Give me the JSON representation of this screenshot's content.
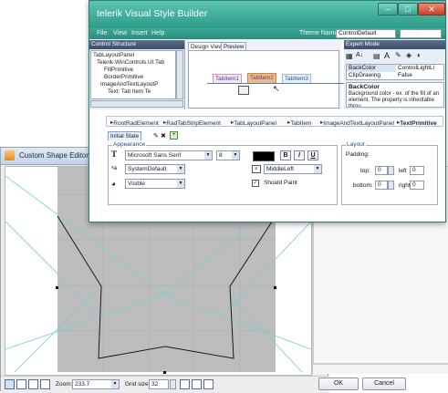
{
  "shape_editor": {
    "title": "Custom Shape Editor",
    "zoom_label": "Zoom:",
    "zoom_value": "233.7",
    "grid_label": "Grid size:",
    "grid_value": "32",
    "ok_label": "OK",
    "cancel_label": "Cancel"
  },
  "builder": {
    "title": "telerik Visual Style Builder",
    "menu": [
      "File",
      "View",
      "Insert",
      "Help"
    ],
    "theme_label": "Theme Name",
    "theme_value": "ControlDefault",
    "zoom_value": "100%",
    "control_structure": {
      "header": "Control Structure",
      "items": [
        "TabLayoutPanel",
        "Telerik.WinControls.UI.Tab",
        "FillPrimitive",
        "BorderPrimitive",
        "ImageAndTextLayoutP",
        "Text: Tab Item Te"
      ]
    },
    "design_tabs": [
      "Design View",
      "Preview"
    ],
    "preview_items": [
      "TabItem1",
      "TabItem2",
      "TabItem3"
    ],
    "expert_mode": {
      "header": "Expert Mode",
      "rows": [
        {
          "name": "BackColor",
          "value": "ControlLightLi"
        },
        {
          "name": "ClipDrawing",
          "value": "False"
        }
      ],
      "desc_title": "BackColor",
      "desc_text": "Background color - ex. of the fill of an element. The property is inheritable throu..."
    },
    "breadcrumb": [
      "RootRadElement",
      "RadTabStripElement",
      "TabLayoutPanel",
      "TabItem",
      "ImageAndTextLayoutPanel",
      "TextPrimitive"
    ],
    "state_tab": "Initial State",
    "appearance": {
      "label": "Appearance",
      "font_name": "Microsoft Sans Serif",
      "font_size": "8",
      "bold": "B",
      "italic": "I",
      "underline": "U",
      "rendering": "SystemDefault",
      "alignment": "MiddleLeft",
      "visibility": "Visible",
      "should_paint_label": "Should Paint",
      "should_paint_checked": true
    },
    "layout": {
      "label": "Layout",
      "padding_label": "Padding:",
      "top_label": "top:",
      "top_value": "0",
      "left_label": "left",
      "left_value": "0",
      "bottom_label": "bottom:",
      "bottom_value": "0",
      "right_label": "right",
      "right_value": "0"
    }
  },
  "colors": {
    "title_teal": "#2b9b88",
    "panel_header": "#3b4f6e",
    "canvas_gray": "#bdbdbd"
  }
}
